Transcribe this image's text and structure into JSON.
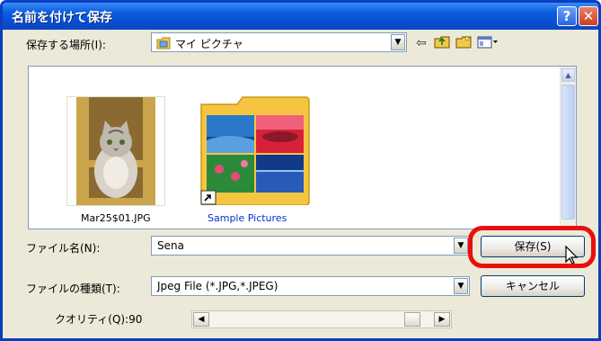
{
  "window": {
    "title": "名前を付けて保存",
    "help_glyph": "?",
    "close_glyph": "✕"
  },
  "location": {
    "label": "保存する場所(I):",
    "value": "マイ ピクチャ"
  },
  "toolbar": {
    "back_glyph": "⇦"
  },
  "files": [
    {
      "name": "Mar25$01.JPG",
      "type": "image"
    },
    {
      "name": "Sample Pictures",
      "type": "folder-shortcut"
    }
  ],
  "filename": {
    "label": "ファイル名(N):",
    "value": "Sena"
  },
  "filetype": {
    "label": "ファイルの種類(T):",
    "value": "Jpeg File (*.JPG,*.JPEG)"
  },
  "quality": {
    "label": "クオリティ(Q):90",
    "value": 90
  },
  "buttons": {
    "save": "保存(S)",
    "cancel": "キャンセル"
  },
  "colors": {
    "titlebar": "#0a4fd0",
    "highlight_ring": "#e8100c",
    "folder_name_link": "#0033cc"
  }
}
